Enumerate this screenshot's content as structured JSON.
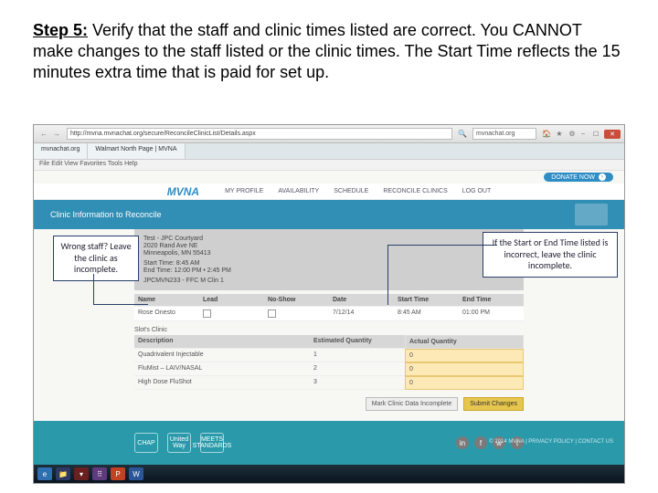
{
  "step": {
    "lead": "Step 5:",
    "body": " Verify that the staff and clinic times listed are correct.  You CANNOT make changes to the staff listed or the clinic times.  The Start Time reflects the 15 minutes extra time that is paid for set up."
  },
  "browser": {
    "url": "http://mvna.mvnachat.org/secure/ReconcileClinicList/Details.aspx",
    "search_placeholder": "mvnachat.org",
    "tab1": "mvnachat.org",
    "tab2": "Walmart North Page | MVNA",
    "win_min": "–",
    "win_max": "☐",
    "win_close": "✕",
    "menus": "File  Edit  View  Favorites  Tools  Help"
  },
  "donate": {
    "label": "DONATE NOW",
    "arrow": "›"
  },
  "nav": {
    "brand": "MVNA",
    "items": [
      "MY PROFILE",
      "AVAILABILITY",
      "SCHEDULE",
      "RECONCILE CLINICS",
      "LOG OUT"
    ]
  },
  "hero": {
    "title": "Clinic Information to Reconcile"
  },
  "clinic": {
    "line1": "Test - JPC Courtyard",
    "line2": "2020 Rand Ave NE",
    "line3": "Minneapolis, MN 55413",
    "line4": "Start Time: 8:45 AM",
    "line5": "End Time: 12:00 PM • 2:45 PM",
    "line6": "JPCMVN233 - FFC M Clin 1"
  },
  "staff_table": {
    "headers": [
      "Name",
      "Lead",
      "No-Show",
      "Date",
      "Start Time",
      "End Time"
    ],
    "row": {
      "name": "Rose Onesto",
      "date": "7/12/14",
      "start": "8:45 AM",
      "end": "01:00 PM"
    }
  },
  "section": {
    "label": "Slot's Clinic "
  },
  "qty_table": {
    "headers": [
      "Description",
      "Estimated Quantity",
      "Actual Quantity"
    ],
    "rows": [
      {
        "desc": "Quadrivalent Injectable",
        "est": "1",
        "act": "0"
      },
      {
        "desc": "FluMist – LAIV/NASAL",
        "est": "2",
        "act": "0"
      },
      {
        "desc": "High Dose FluShot",
        "est": "3",
        "act": "0"
      }
    ]
  },
  "buttons": {
    "mark": "Mark Clinic Data Incomplete",
    "submit": "Submit Changes"
  },
  "footer": {
    "logo1": "CHAP",
    "logo2": "United Way",
    "logo3": "MEETS STANDARDS",
    "legal": "© 2014 MVNA | PRIVACY POLICY | CONTACT US"
  },
  "socials": {
    "in": "in",
    "fb": "f",
    "wp": "w",
    "tw": "t"
  },
  "callouts": {
    "left": "Wrong staff? Leave the clinic as incomplete.",
    "right": "If the Start or End Time listed is incorrect, leave the clinic incomplete."
  },
  "taskbar": {
    "ie": "e",
    "fx": "📁",
    "rec": "▾",
    "dots": "⠿",
    "ppt": "P",
    "wrd": "W"
  }
}
